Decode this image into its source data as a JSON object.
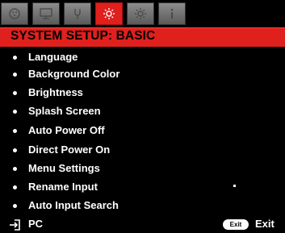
{
  "tabs": [
    {
      "icon": "picture-icon",
      "active": false
    },
    {
      "icon": "screen-icon",
      "active": false
    },
    {
      "icon": "settings-icon",
      "active": false
    },
    {
      "icon": "gear-icon",
      "active": true
    },
    {
      "icon": "advanced-gear-icon",
      "active": false
    },
    {
      "icon": "info-icon",
      "active": false
    }
  ],
  "header": {
    "title": "SYSTEM SETUP: BASIC"
  },
  "menu": {
    "items": [
      {
        "label": "Language"
      },
      {
        "label": "Background Color"
      },
      {
        "label": "Brightness"
      },
      {
        "label": "Splash Screen"
      },
      {
        "label": "Auto Power Off"
      },
      {
        "label": "Direct Power On"
      },
      {
        "label": "Menu Settings"
      },
      {
        "label": "Rename Input"
      },
      {
        "label": "Auto Input Search"
      }
    ]
  },
  "footer": {
    "source_label": "PC",
    "exit_button_text": "Exit",
    "exit_label": "Exit"
  },
  "colors": {
    "accent": "#e0201d",
    "tab": "#7a7a7a"
  }
}
